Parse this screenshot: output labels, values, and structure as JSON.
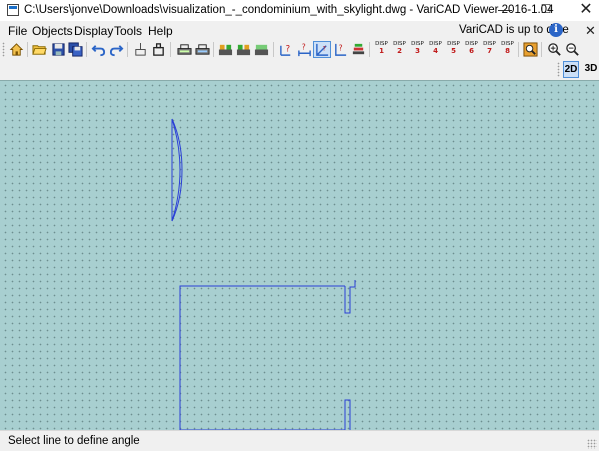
{
  "window": {
    "title": "C:\\Users\\jonve\\Downloads\\visualization_-_condominium_with_skylight.dwg - VariCAD Viewer 2016-1.04",
    "minimize_glyph": "—",
    "maximize_glyph": "☐",
    "close_glyph": "✕"
  },
  "menu": {
    "items": [
      "File",
      "Objects",
      "Display",
      "Tools",
      "Help"
    ],
    "update_notice": "VariCAD is up to date",
    "info_glyph": "i",
    "close_glyph": "✕"
  },
  "toolbar": {
    "icons": [
      "home-icon",
      "open-folder-icon",
      "save-icon",
      "save-as-icon",
      "undo-icon",
      "redo-icon",
      "select-icon",
      "layer-icon",
      "print-icon",
      "print-setup-icon",
      "disp-all-icon",
      "disp-set-icon",
      "disp-filter-icon",
      "angle-question-icon",
      "distance-icon",
      "angle-line-icon",
      "measure-icon",
      "zoom-window-icon",
      "zoom-in-icon",
      "zoom-out-icon"
    ],
    "disp_buttons": [
      {
        "top": "DISP",
        "num": "1"
      },
      {
        "top": "DISP",
        "num": "2"
      },
      {
        "top": "DISP",
        "num": "3"
      },
      {
        "top": "DISP",
        "num": "4"
      },
      {
        "top": "DISP",
        "num": "5"
      },
      {
        "top": "DISP",
        "num": "6"
      },
      {
        "top": "DISP",
        "num": "7"
      },
      {
        "top": "DISP",
        "num": "8"
      }
    ],
    "active_tool": "angle-line-icon"
  },
  "view_mode": {
    "two_d": "2D",
    "three_d": "3D",
    "active": "2D"
  },
  "canvas": {
    "background": "#a8cfd0",
    "line_color": "#2a3fd6"
  },
  "status": {
    "text": "Select line to define angle"
  }
}
